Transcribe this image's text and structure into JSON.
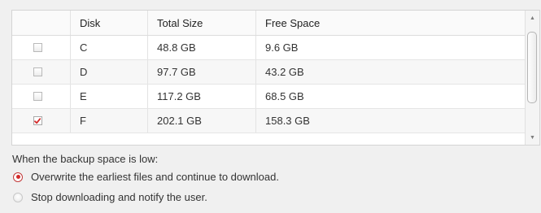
{
  "disk_table": {
    "headers": [
      "",
      "Disk",
      "Total Size",
      "Free Space"
    ],
    "rows": [
      {
        "checked": false,
        "disk": "C",
        "total": "48.8 GB",
        "free": "9.6 GB"
      },
      {
        "checked": false,
        "disk": "D",
        "total": "97.7 GB",
        "free": "43.2 GB"
      },
      {
        "checked": false,
        "disk": "E",
        "total": "117.2 GB",
        "free": "68.5 GB"
      },
      {
        "checked": true,
        "disk": "F",
        "total": "202.1 GB",
        "free": "158.3 GB"
      }
    ]
  },
  "scrollbar": {
    "up_icon": "scroll-up-arrow-icon",
    "down_icon": "scroll-down-arrow-icon"
  },
  "backup_options": {
    "label": "When the backup space is low:",
    "selected_index": 0,
    "options": [
      "Overwrite the earliest files and continue to download.",
      "Stop downloading and notify the user."
    ]
  },
  "colors": {
    "accent": "#d42b2b",
    "background": "#f0f0f0",
    "table_background": "#ffffff"
  }
}
